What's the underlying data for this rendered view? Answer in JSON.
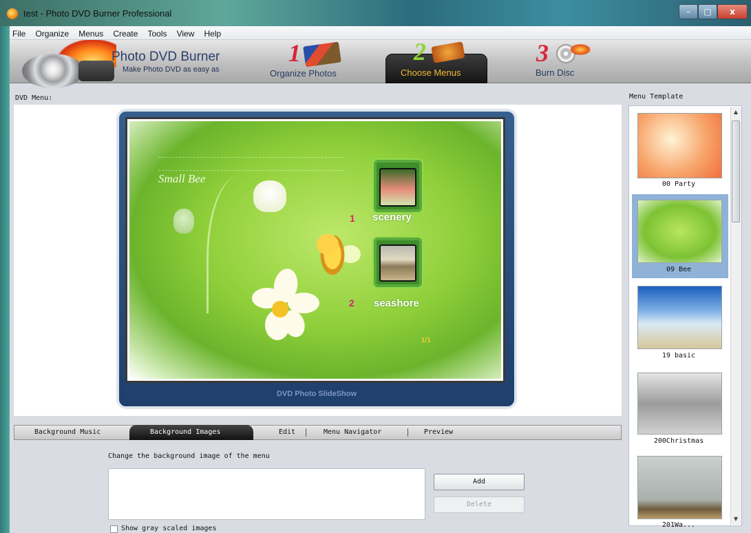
{
  "window": {
    "title": "test - Photo DVD Burner Professional",
    "minimize": "–",
    "maximize": "□",
    "close": "x"
  },
  "menubar": [
    "File",
    "Organize",
    "Menus",
    "Create",
    "Tools",
    "View",
    "Help"
  ],
  "banner": {
    "brand_title": "Photo DVD Burner",
    "brand_tagline": "Make Photo DVD as easy as",
    "steps": [
      {
        "num": "1",
        "label": "Organize Photos"
      },
      {
        "num": "2",
        "label": "Choose Menus",
        "active": true
      },
      {
        "num": "3",
        "label": "Burn Disc"
      }
    ]
  },
  "labels": {
    "dvd_menu": "DVD Menu:",
    "menu_template": "Menu Template"
  },
  "preview": {
    "heading": "Small Bee",
    "items": [
      {
        "num": "1",
        "label": "scenery"
      },
      {
        "num": "2",
        "label": "seashore"
      }
    ],
    "page": "1/1",
    "footer": "DVD Photo SlideShow"
  },
  "tabs": {
    "background_music": "Background Music",
    "background_images": "Background Images",
    "edit": "Edit",
    "menu_navigator": "Menu Navigator",
    "preview": "Preview",
    "active": "Background Images"
  },
  "background": {
    "description": "Change the background image of the menu",
    "add": "Add",
    "delete": "Delete",
    "show_gray": "Show gray scaled images"
  },
  "templates": [
    {
      "label": "00 Party"
    },
    {
      "label": "09 Bee",
      "selected": true
    },
    {
      "label": "19 basic"
    },
    {
      "label": "200Christmas"
    },
    {
      "label": "201Wa..."
    }
  ]
}
